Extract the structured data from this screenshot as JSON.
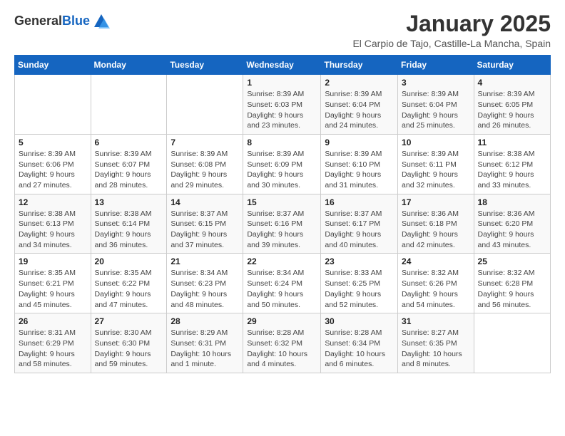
{
  "header": {
    "logo_line1": "General",
    "logo_line2": "Blue",
    "title": "January 2025",
    "subtitle": "El Carpio de Tajo, Castille-La Mancha, Spain"
  },
  "weekdays": [
    "Sunday",
    "Monday",
    "Tuesday",
    "Wednesday",
    "Thursday",
    "Friday",
    "Saturday"
  ],
  "weeks": [
    [
      {
        "day": "",
        "detail": ""
      },
      {
        "day": "",
        "detail": ""
      },
      {
        "day": "",
        "detail": ""
      },
      {
        "day": "1",
        "detail": "Sunrise: 8:39 AM\nSunset: 6:03 PM\nDaylight: 9 hours\nand 23 minutes."
      },
      {
        "day": "2",
        "detail": "Sunrise: 8:39 AM\nSunset: 6:04 PM\nDaylight: 9 hours\nand 24 minutes."
      },
      {
        "day": "3",
        "detail": "Sunrise: 8:39 AM\nSunset: 6:04 PM\nDaylight: 9 hours\nand 25 minutes."
      },
      {
        "day": "4",
        "detail": "Sunrise: 8:39 AM\nSunset: 6:05 PM\nDaylight: 9 hours\nand 26 minutes."
      }
    ],
    [
      {
        "day": "5",
        "detail": "Sunrise: 8:39 AM\nSunset: 6:06 PM\nDaylight: 9 hours\nand 27 minutes."
      },
      {
        "day": "6",
        "detail": "Sunrise: 8:39 AM\nSunset: 6:07 PM\nDaylight: 9 hours\nand 28 minutes."
      },
      {
        "day": "7",
        "detail": "Sunrise: 8:39 AM\nSunset: 6:08 PM\nDaylight: 9 hours\nand 29 minutes."
      },
      {
        "day": "8",
        "detail": "Sunrise: 8:39 AM\nSunset: 6:09 PM\nDaylight: 9 hours\nand 30 minutes."
      },
      {
        "day": "9",
        "detail": "Sunrise: 8:39 AM\nSunset: 6:10 PM\nDaylight: 9 hours\nand 31 minutes."
      },
      {
        "day": "10",
        "detail": "Sunrise: 8:39 AM\nSunset: 6:11 PM\nDaylight: 9 hours\nand 32 minutes."
      },
      {
        "day": "11",
        "detail": "Sunrise: 8:38 AM\nSunset: 6:12 PM\nDaylight: 9 hours\nand 33 minutes."
      }
    ],
    [
      {
        "day": "12",
        "detail": "Sunrise: 8:38 AM\nSunset: 6:13 PM\nDaylight: 9 hours\nand 34 minutes."
      },
      {
        "day": "13",
        "detail": "Sunrise: 8:38 AM\nSunset: 6:14 PM\nDaylight: 9 hours\nand 36 minutes."
      },
      {
        "day": "14",
        "detail": "Sunrise: 8:37 AM\nSunset: 6:15 PM\nDaylight: 9 hours\nand 37 minutes."
      },
      {
        "day": "15",
        "detail": "Sunrise: 8:37 AM\nSunset: 6:16 PM\nDaylight: 9 hours\nand 39 minutes."
      },
      {
        "day": "16",
        "detail": "Sunrise: 8:37 AM\nSunset: 6:17 PM\nDaylight: 9 hours\nand 40 minutes."
      },
      {
        "day": "17",
        "detail": "Sunrise: 8:36 AM\nSunset: 6:18 PM\nDaylight: 9 hours\nand 42 minutes."
      },
      {
        "day": "18",
        "detail": "Sunrise: 8:36 AM\nSunset: 6:20 PM\nDaylight: 9 hours\nand 43 minutes."
      }
    ],
    [
      {
        "day": "19",
        "detail": "Sunrise: 8:35 AM\nSunset: 6:21 PM\nDaylight: 9 hours\nand 45 minutes."
      },
      {
        "day": "20",
        "detail": "Sunrise: 8:35 AM\nSunset: 6:22 PM\nDaylight: 9 hours\nand 47 minutes."
      },
      {
        "day": "21",
        "detail": "Sunrise: 8:34 AM\nSunset: 6:23 PM\nDaylight: 9 hours\nand 48 minutes."
      },
      {
        "day": "22",
        "detail": "Sunrise: 8:34 AM\nSunset: 6:24 PM\nDaylight: 9 hours\nand 50 minutes."
      },
      {
        "day": "23",
        "detail": "Sunrise: 8:33 AM\nSunset: 6:25 PM\nDaylight: 9 hours\nand 52 minutes."
      },
      {
        "day": "24",
        "detail": "Sunrise: 8:32 AM\nSunset: 6:26 PM\nDaylight: 9 hours\nand 54 minutes."
      },
      {
        "day": "25",
        "detail": "Sunrise: 8:32 AM\nSunset: 6:28 PM\nDaylight: 9 hours\nand 56 minutes."
      }
    ],
    [
      {
        "day": "26",
        "detail": "Sunrise: 8:31 AM\nSunset: 6:29 PM\nDaylight: 9 hours\nand 58 minutes."
      },
      {
        "day": "27",
        "detail": "Sunrise: 8:30 AM\nSunset: 6:30 PM\nDaylight: 9 hours\nand 59 minutes."
      },
      {
        "day": "28",
        "detail": "Sunrise: 8:29 AM\nSunset: 6:31 PM\nDaylight: 10 hours\nand 1 minute."
      },
      {
        "day": "29",
        "detail": "Sunrise: 8:28 AM\nSunset: 6:32 PM\nDaylight: 10 hours\nand 4 minutes."
      },
      {
        "day": "30",
        "detail": "Sunrise: 8:28 AM\nSunset: 6:34 PM\nDaylight: 10 hours\nand 6 minutes."
      },
      {
        "day": "31",
        "detail": "Sunrise: 8:27 AM\nSunset: 6:35 PM\nDaylight: 10 hours\nand 8 minutes."
      },
      {
        "day": "",
        "detail": ""
      }
    ]
  ]
}
